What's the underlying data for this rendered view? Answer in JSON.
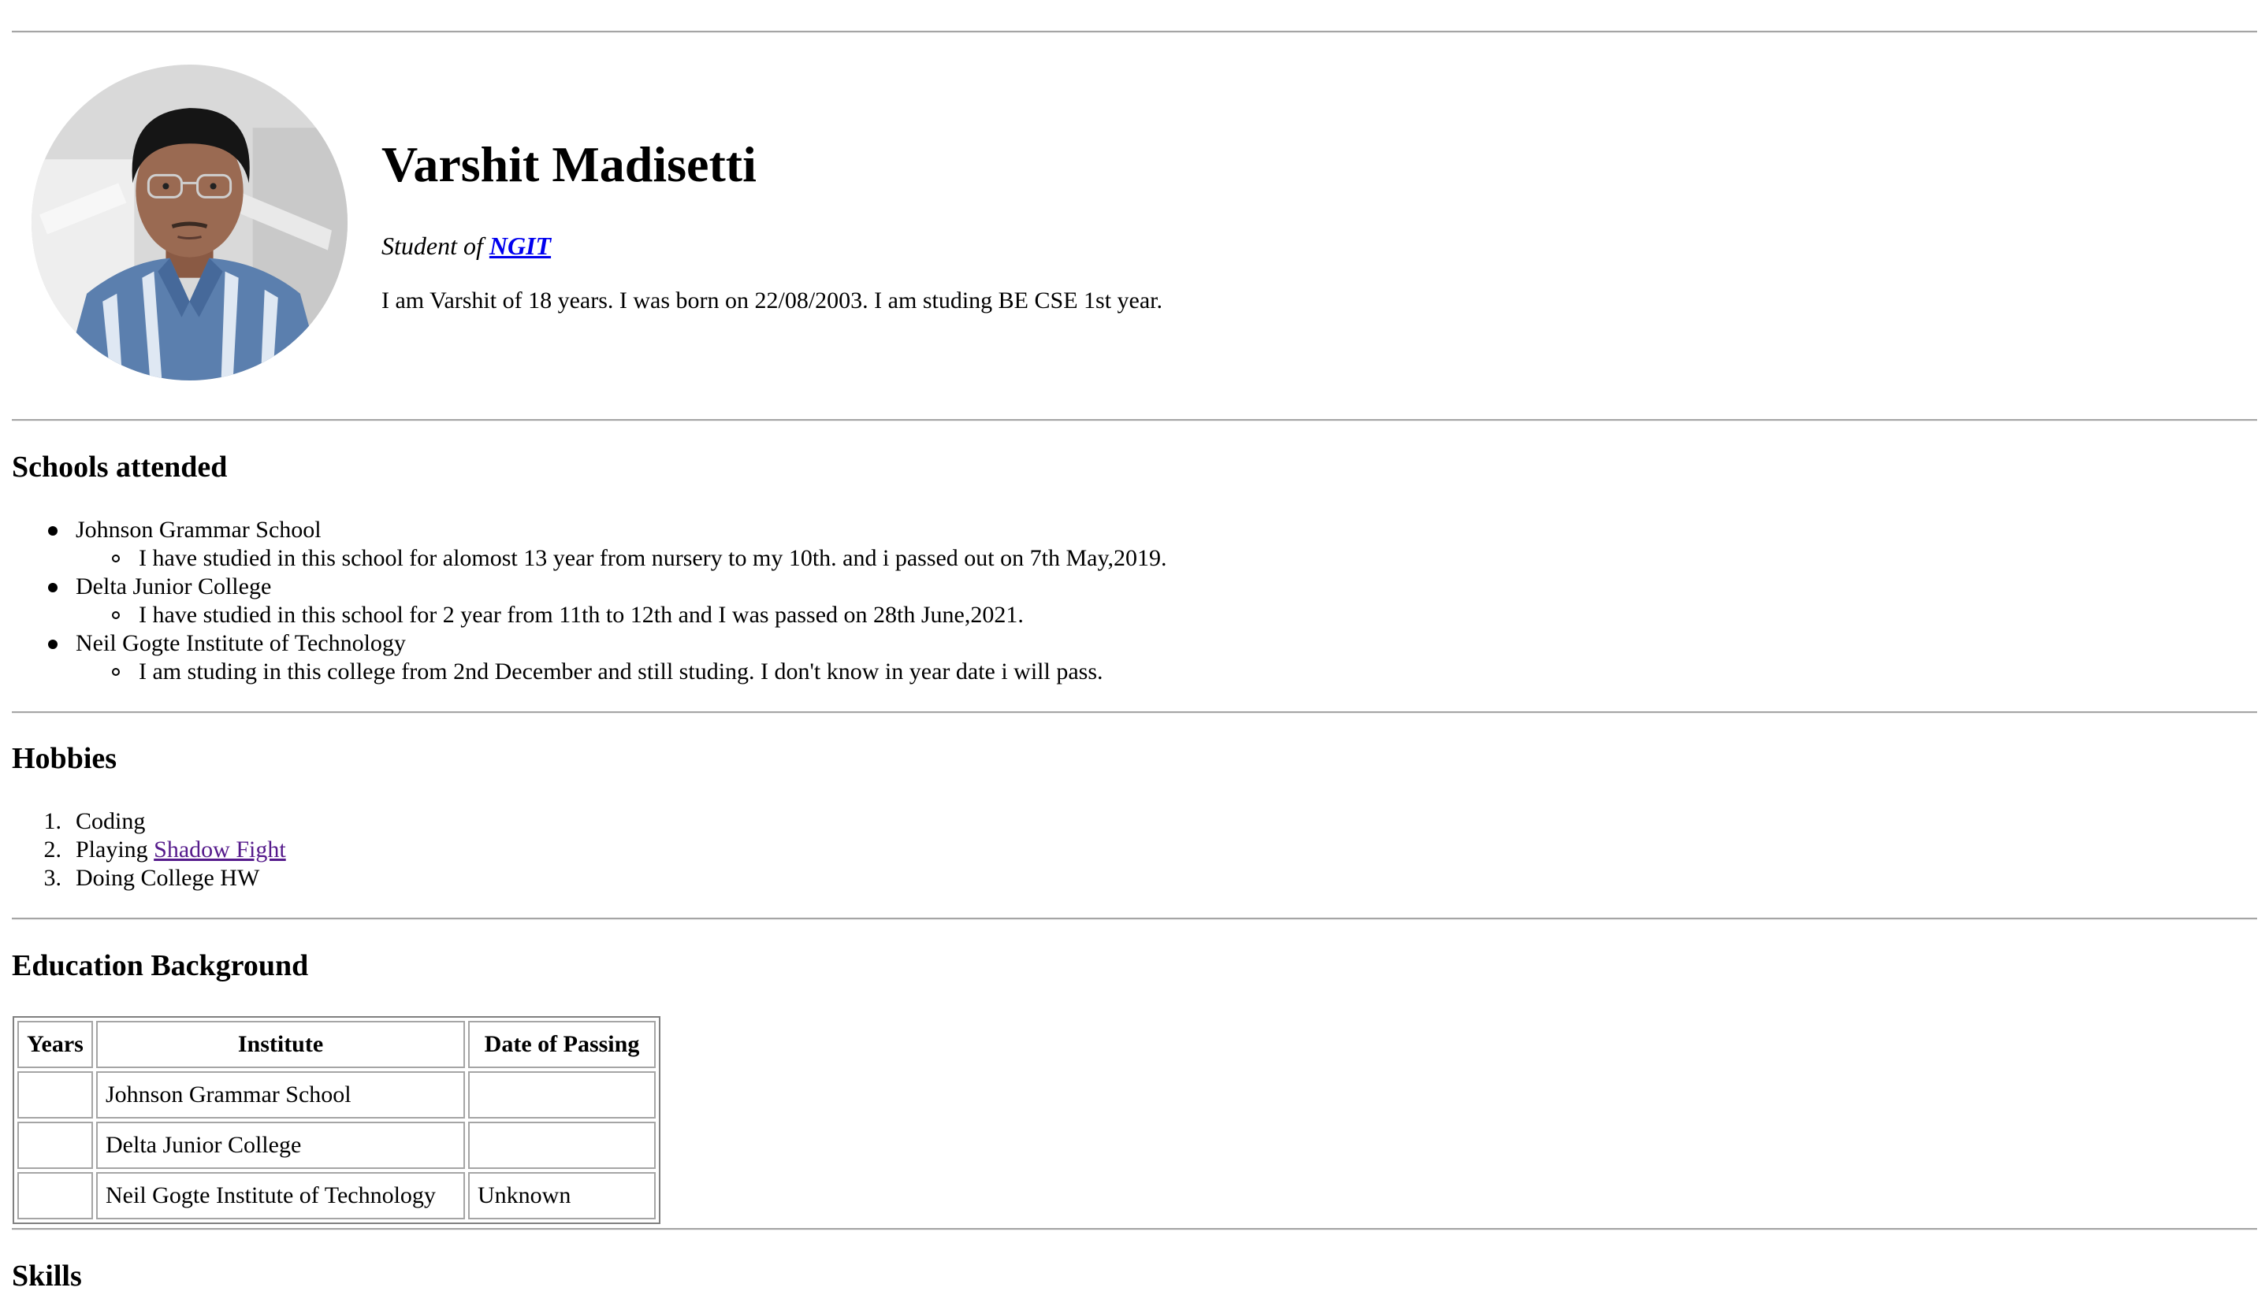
{
  "profile": {
    "name": "Varshit Madisetti",
    "subtitle_prefix": "Student of ",
    "subtitle_link": "NGIT",
    "bio": "I am Varshit of 18 years. I was born on 22/08/2003. I am studing BE CSE 1st year."
  },
  "schools": {
    "heading": "Schools attended",
    "items": [
      {
        "name": "Johnson Grammar School",
        "detail": "I have studied in this school for alomost 13 year from nursery to my 10th. and i passed out on 7th May,2019."
      },
      {
        "name": "Delta Junior College",
        "detail": "I have studied in this school for 2 year from 11th to 12th and I was passed on 28th June,2021."
      },
      {
        "name": "Neil Gogte Institute of Technology",
        "detail": "I am studing in this college from 2nd December and still studing. I don't know in year date i will pass."
      }
    ]
  },
  "hobbies": {
    "heading": "Hobbies",
    "items": [
      {
        "number": "1.",
        "text": "Coding",
        "link": ""
      },
      {
        "number": "2.",
        "text": "Playing ",
        "link": "Shadow Fight"
      },
      {
        "number": "3.",
        "text": "Doing College HW",
        "link": ""
      }
    ]
  },
  "education": {
    "heading": "Education Background",
    "columns": [
      "Years",
      "Institute",
      "Date of Passing"
    ],
    "rows": [
      [
        "",
        "Johnson Grammar School",
        ""
      ],
      [
        "",
        "Delta Junior College",
        ""
      ],
      [
        "",
        "Neil Gogte Institute of Technology",
        "Unknown"
      ]
    ]
  },
  "skills": {
    "heading": "Skills"
  },
  "colors": {
    "link": "#0000ee",
    "visited_link": "#551a8b",
    "rule": "#a5a5a5"
  }
}
